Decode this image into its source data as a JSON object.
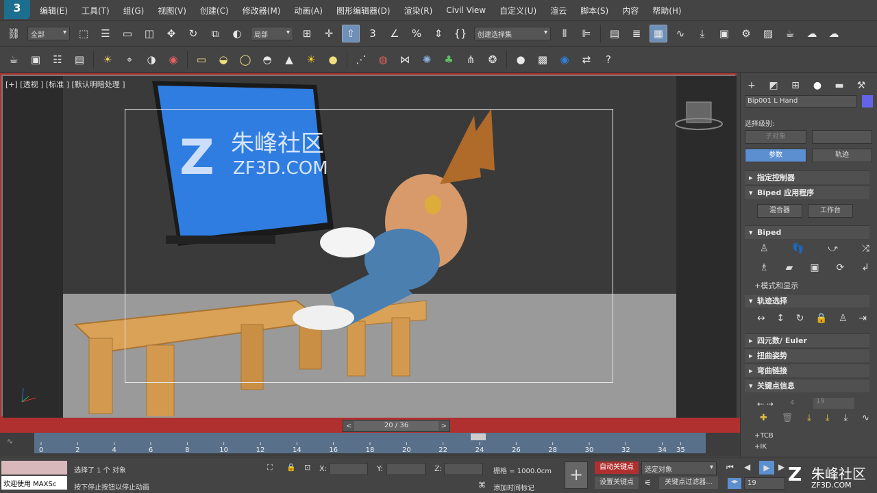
{
  "menu": {
    "logo": "3",
    "items": [
      "编辑(E)",
      "工具(T)",
      "组(G)",
      "视图(V)",
      "创建(C)",
      "修改器(M)",
      "动画(A)",
      "图形编辑器(D)",
      "渲染(R)",
      "Civil View",
      "自定义(U)",
      "渲云",
      "脚本(S)",
      "内容",
      "帮助(H)"
    ]
  },
  "toolbar": {
    "filter_select": "全部",
    "coord_select": "局部",
    "named_selection": "创建选择集",
    "snap_label": "3"
  },
  "viewport": {
    "label": "[+] [透视 ] [标准 ] [默认明暗处理 ]",
    "watermark_cn": "朱峰社区",
    "watermark_en": "ZF3D.COM"
  },
  "timeslider": {
    "prev": "<",
    "next": ">",
    "frame": "20 / 36"
  },
  "timeline": {
    "ticks": [
      "0",
      "2",
      "4",
      "6",
      "8",
      "10",
      "12",
      "14",
      "16",
      "18",
      "20",
      "22",
      "24",
      "26",
      "28",
      "30",
      "32",
      "34",
      "35"
    ]
  },
  "status": {
    "maxscript": "欢迎使用 MAXSc",
    "selected": "选择了 1 个 对象",
    "prompt": "按下停止按钮以停止动画",
    "x_label": "X:",
    "y_label": "Y:",
    "z_label": "Z:",
    "grid": "栅格 = 1000.0cm",
    "add_time_tag": "添加时间标记",
    "auto_key": "自动关键点",
    "set_key": "设置关键点",
    "selected_obj": "选定对象",
    "key_filters": "关键点过滤器...",
    "frame_value": "19",
    "brand_cn": "朱峰社区",
    "brand_en": "ZF3D.COM"
  },
  "panel": {
    "object_name": "Bip001 L Hand",
    "select_level": "选择级别:",
    "sub_object": "子对象",
    "params": "参数",
    "track": "轨迹",
    "rollouts": {
      "assign": "指定控制器",
      "apps": "Biped 应用程序",
      "biped": "Biped",
      "modes": "+模式和显示",
      "track_sel": "轨迹选择",
      "quat": "四元数/ Euler",
      "twist": "扭曲姿势",
      "bend": "弯曲链接",
      "keyinfo": "关键点信息"
    },
    "mixer": "混合器",
    "workbench": "工作台",
    "key_num": "4",
    "key_total": "19",
    "tcb": "+TCB",
    "ik": "+IK"
  },
  "colors": {
    "accent": "#5c8fd0",
    "autokey": "#b03030",
    "viewport_border": "#b03030"
  }
}
